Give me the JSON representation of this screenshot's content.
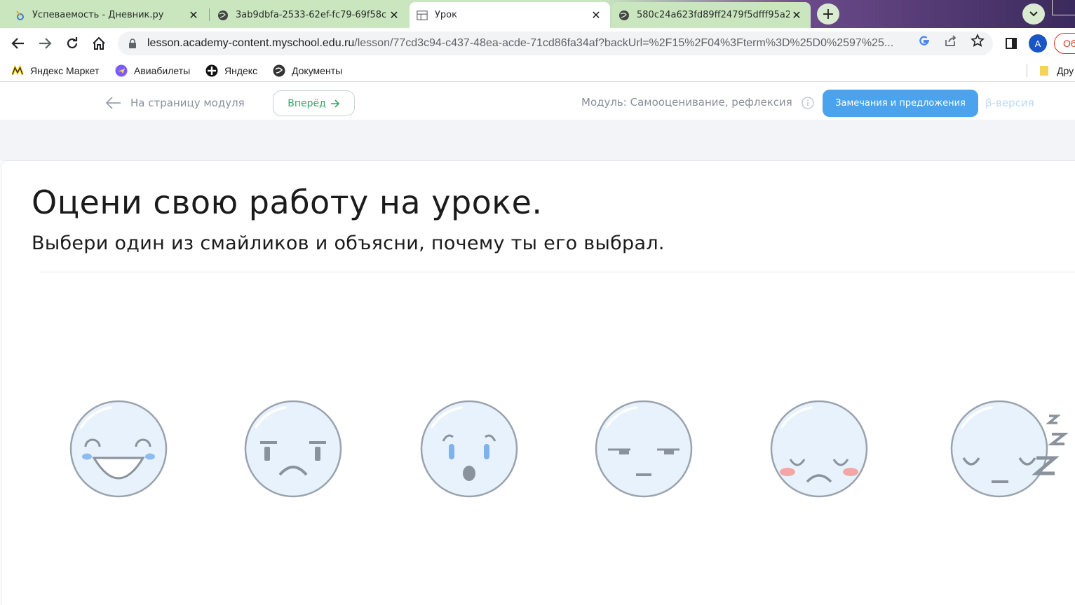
{
  "browser": {
    "tabs": [
      {
        "title": "Успеваемость - Дневник.ру",
        "icon": "diary-favicon-icon",
        "active": false
      },
      {
        "title": "3ab9dbfa-2533-62ef-fc79-69f58c",
        "icon": "globe-icon",
        "active": false
      },
      {
        "title": "Урок",
        "icon": "lesson-page-icon",
        "active": true
      },
      {
        "title": "580c24a623fd89ff2479f5dfff95a2",
        "icon": "globe-icon",
        "active": false
      }
    ],
    "address": {
      "host": "lesson.academy-content.myschool.edu.ru",
      "path": "/lesson/77cd3c94-c437-48ea-acde-71cd86fa34af?backUrl=%2F15%2F04%3Fterm%3D%25D0%2597%25..."
    },
    "profile_initial": "A",
    "update_label": "Об",
    "bookmarks": [
      {
        "label": "Яндекс Маркет",
        "icon": "yandex-market-icon"
      },
      {
        "label": "Авиабилеты",
        "icon": "plane-tickets-icon"
      },
      {
        "label": "Яндекс",
        "icon": "yandex-icon"
      },
      {
        "label": "Документы",
        "icon": "documents-icon"
      }
    ],
    "other_bookmarks": "Дру"
  },
  "header": {
    "back_label": "На страницу модуля",
    "forward_label": "Вперёд",
    "module_label": "Модуль: Самооценивание, рефлексия",
    "feedback_label": "Замечания и предложения",
    "beta_label": "β-версия"
  },
  "content": {
    "title": "Оцени свою работу на уроке.",
    "subtitle": "Выбери один из смайликов и объясни, почему ты его выбрал.",
    "smileys": [
      "happy-smiley",
      "sad-smiley",
      "surprised-smiley",
      "unimpressed-smiley",
      "upset-blushing-smiley",
      "sleepy-smiley"
    ]
  },
  "colors": {
    "tab_green": "#c9e6bf",
    "accent_blue": "#4aa3ec",
    "forward_green": "#3aa26b",
    "smiley_fill": "#e8f2fc",
    "smiley_stroke": "#9aa3ad"
  }
}
